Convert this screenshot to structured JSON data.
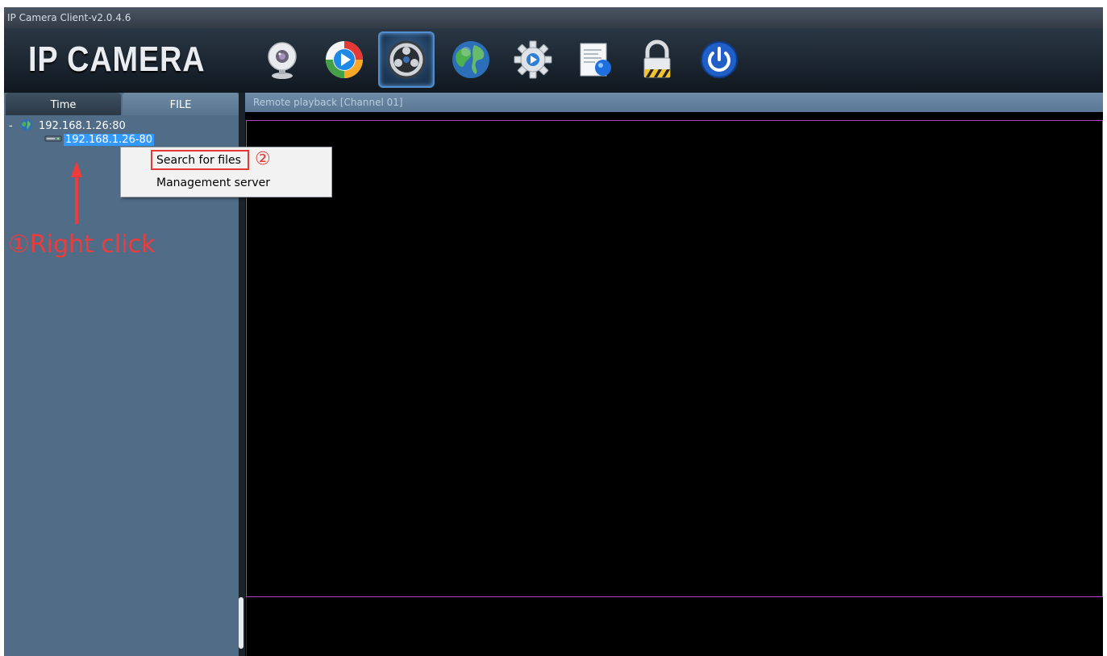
{
  "window": {
    "title": "IP Camera Client-v2.0.4.6"
  },
  "header": {
    "logo_text": "IP CAMERA",
    "toolbar": [
      {
        "icon": "webcam-icon",
        "active": false
      },
      {
        "icon": "playback-icon",
        "active": false
      },
      {
        "icon": "film-reel-icon",
        "active": true
      },
      {
        "icon": "globe-icon",
        "active": false
      },
      {
        "icon": "gear-icon",
        "active": false
      },
      {
        "icon": "log-document-icon",
        "active": false
      },
      {
        "icon": "lock-icon",
        "active": false
      },
      {
        "icon": "power-icon",
        "active": false
      }
    ]
  },
  "left_panel": {
    "tabs": [
      {
        "label": "Time",
        "selected": false
      },
      {
        "label": "FILE",
        "selected": true
      }
    ],
    "tree": {
      "root": {
        "collapse_symbol": "-",
        "label": "192.168.1.26:80"
      },
      "child": {
        "label": "192.168.1.26-80",
        "selected": true
      }
    }
  },
  "main": {
    "panel_title": "Remote playback [Channel 01]"
  },
  "context_menu": {
    "items": [
      "Search for files",
      "Management server"
    ]
  },
  "annotations": {
    "step1": "①Right click",
    "step2": "②"
  },
  "colors": {
    "annotation_red": "#e53935",
    "video_border": "#b442c8",
    "selection_blue": "#3399ff"
  }
}
